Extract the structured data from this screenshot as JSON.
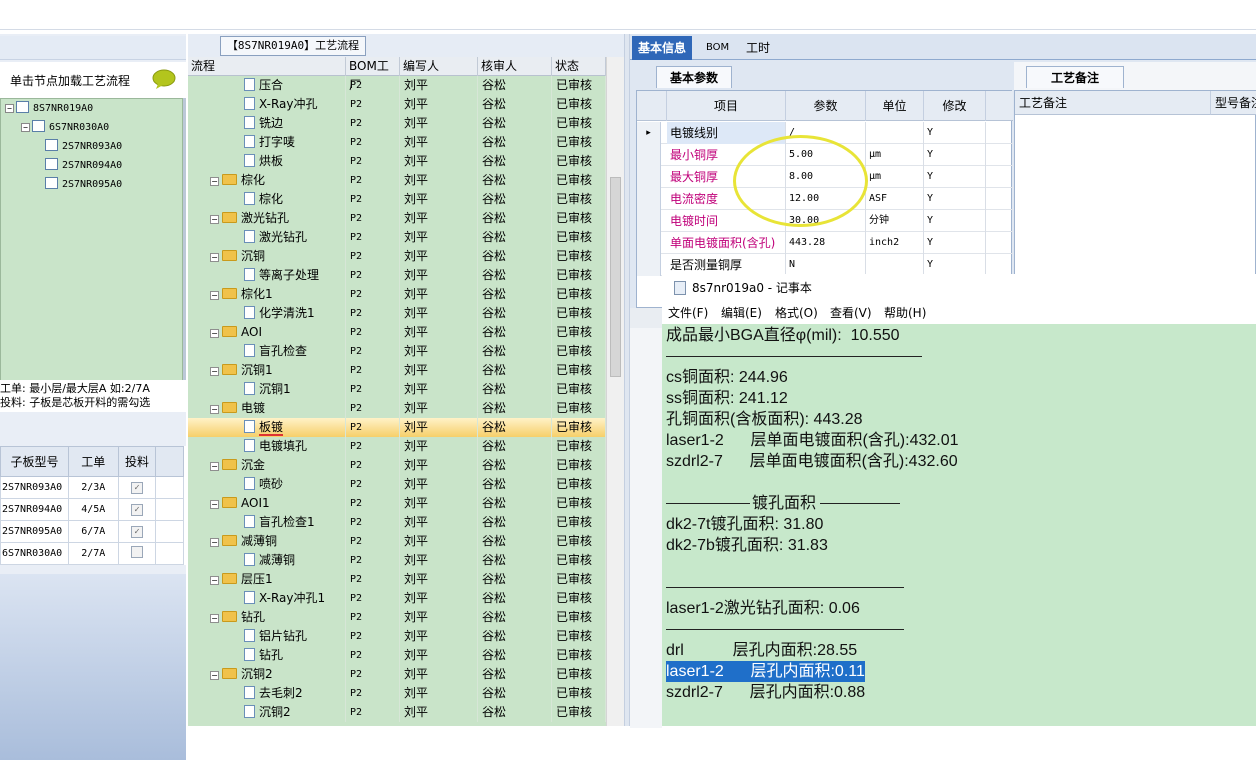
{
  "left": {
    "action_label": "单击节点加载工艺流程",
    "tree": [
      {
        "label": "8S7NR019A0",
        "level": 0
      },
      {
        "label": "6S7NR030A0",
        "level": 1
      },
      {
        "label": "2S7NR093A0",
        "level": 2
      },
      {
        "label": "2S7NR094A0",
        "level": 2
      },
      {
        "label": "2S7NR095A0",
        "level": 2
      }
    ],
    "info_line1": "工单: 最小层/最大层A 如:2/7A",
    "info_line2": "投料: 子板是芯板开料的需勾选",
    "grid_headers": {
      "model": "子板型号",
      "order": "工单",
      "feed": "投料"
    },
    "grid_rows": [
      {
        "model": "2S7NR093A0",
        "order": "2/3A",
        "checked": true
      },
      {
        "model": "2S7NR094A0",
        "order": "4/5A",
        "checked": true
      },
      {
        "model": "2S7NR095A0",
        "order": "6/7A",
        "checked": true
      },
      {
        "model": "6S7NR030A0",
        "order": "2/7A",
        "checked": false
      }
    ]
  },
  "mid": {
    "title": "【8S7NR019A0】工艺流程",
    "headers": {
      "flow": "流程",
      "bom": "BOM工厂",
      "writer": "编写人",
      "reviewer": "核审人",
      "status": "状态"
    },
    "rows": [
      {
        "name": "压合",
        "kind": "doc",
        "bom": "P2",
        "writer": "刘平",
        "reviewer": "谷松",
        "status": "已审核"
      },
      {
        "name": "X-Ray冲孔",
        "kind": "doc",
        "bom": "P2",
        "writer": "刘平",
        "reviewer": "谷松",
        "status": "已审核"
      },
      {
        "name": "铣边",
        "kind": "doc",
        "bom": "P2",
        "writer": "刘平",
        "reviewer": "谷松",
        "status": "已审核"
      },
      {
        "name": "打字唛",
        "kind": "doc",
        "bom": "P2",
        "writer": "刘平",
        "reviewer": "谷松",
        "status": "已审核"
      },
      {
        "name": "烘板",
        "kind": "doc",
        "bom": "P2",
        "writer": "刘平",
        "reviewer": "谷松",
        "status": "已审核"
      },
      {
        "name": "棕化",
        "kind": "folder",
        "bom": "P2",
        "writer": "刘平",
        "reviewer": "谷松",
        "status": "已审核"
      },
      {
        "name": "棕化",
        "kind": "doc",
        "bom": "P2",
        "writer": "刘平",
        "reviewer": "谷松",
        "status": "已审核"
      },
      {
        "name": "激光钻孔",
        "kind": "folder",
        "bom": "P2",
        "writer": "刘平",
        "reviewer": "谷松",
        "status": "已审核"
      },
      {
        "name": "激光钻孔",
        "kind": "doc",
        "bom": "P2",
        "writer": "刘平",
        "reviewer": "谷松",
        "status": "已审核"
      },
      {
        "name": "沉铜",
        "kind": "folder",
        "bom": "P2",
        "writer": "刘平",
        "reviewer": "谷松",
        "status": "已审核"
      },
      {
        "name": "等离子处理",
        "kind": "doc",
        "bom": "P2",
        "writer": "刘平",
        "reviewer": "谷松",
        "status": "已审核"
      },
      {
        "name": "棕化1",
        "kind": "folder",
        "bom": "P2",
        "writer": "刘平",
        "reviewer": "谷松",
        "status": "已审核"
      },
      {
        "name": "化学清洗1",
        "kind": "doc",
        "bom": "P2",
        "writer": "刘平",
        "reviewer": "谷松",
        "status": "已审核"
      },
      {
        "name": "AOI",
        "kind": "folder",
        "bom": "P2",
        "writer": "刘平",
        "reviewer": "谷松",
        "status": "已审核"
      },
      {
        "name": "盲孔检查",
        "kind": "doc",
        "bom": "P2",
        "writer": "刘平",
        "reviewer": "谷松",
        "status": "已审核"
      },
      {
        "name": "沉铜1",
        "kind": "folder",
        "bom": "P2",
        "writer": "刘平",
        "reviewer": "谷松",
        "status": "已审核"
      },
      {
        "name": "沉铜1",
        "kind": "doc",
        "bom": "P2",
        "writer": "刘平",
        "reviewer": "谷松",
        "status": "已审核"
      },
      {
        "name": "电镀",
        "kind": "folder",
        "bom": "P2",
        "writer": "刘平",
        "reviewer": "谷松",
        "status": "已审核"
      },
      {
        "name": "板镀",
        "kind": "doc",
        "bom": "P2",
        "writer": "刘平",
        "reviewer": "谷松",
        "status": "已审核",
        "selected": true
      },
      {
        "name": "电镀填孔",
        "kind": "doc",
        "bom": "P2",
        "writer": "刘平",
        "reviewer": "谷松",
        "status": "已审核"
      },
      {
        "name": "沉金",
        "kind": "folder",
        "bom": "P2",
        "writer": "刘平",
        "reviewer": "谷松",
        "status": "已审核"
      },
      {
        "name": "喷砂",
        "kind": "doc",
        "bom": "P2",
        "writer": "刘平",
        "reviewer": "谷松",
        "status": "已审核"
      },
      {
        "name": "AOI1",
        "kind": "folder",
        "bom": "P2",
        "writer": "刘平",
        "reviewer": "谷松",
        "status": "已审核"
      },
      {
        "name": "盲孔检查1",
        "kind": "doc",
        "bom": "P2",
        "writer": "刘平",
        "reviewer": "谷松",
        "status": "已审核"
      },
      {
        "name": "减薄铜",
        "kind": "folder",
        "bom": "P2",
        "writer": "刘平",
        "reviewer": "谷松",
        "status": "已审核"
      },
      {
        "name": "减薄铜",
        "kind": "doc",
        "bom": "P2",
        "writer": "刘平",
        "reviewer": "谷松",
        "status": "已审核"
      },
      {
        "name": "层压1",
        "kind": "folder",
        "bom": "P2",
        "writer": "刘平",
        "reviewer": "谷松",
        "status": "已审核"
      },
      {
        "name": "X-Ray冲孔1",
        "kind": "doc",
        "bom": "P2",
        "writer": "刘平",
        "reviewer": "谷松",
        "status": "已审核"
      },
      {
        "name": "钻孔",
        "kind": "folder",
        "bom": "P2",
        "writer": "刘平",
        "reviewer": "谷松",
        "status": "已审核"
      },
      {
        "name": "铝片钻孔",
        "kind": "doc",
        "bom": "P2",
        "writer": "刘平",
        "reviewer": "谷松",
        "status": "已审核"
      },
      {
        "name": "钻孔",
        "kind": "doc",
        "bom": "P2",
        "writer": "刘平",
        "reviewer": "谷松",
        "status": "已审核"
      },
      {
        "name": "沉铜2",
        "kind": "folder",
        "bom": "P2",
        "writer": "刘平",
        "reviewer": "谷松",
        "status": "已审核"
      },
      {
        "name": "去毛刺2",
        "kind": "doc",
        "bom": "P2",
        "writer": "刘平",
        "reviewer": "谷松",
        "status": "已审核"
      },
      {
        "name": "沉铜2",
        "kind": "doc",
        "bom": "P2",
        "writer": "刘平",
        "reviewer": "谷松",
        "status": "已审核"
      }
    ]
  },
  "right": {
    "tabs": [
      "基本信息",
      "BOM",
      "工时"
    ],
    "subtab_basic": "基本参数",
    "subtab_note": "工艺备注",
    "param_headers": {
      "item": "项目",
      "param": "参数",
      "unit": "单位",
      "modify": "修改"
    },
    "params": [
      {
        "item": "电镀线别",
        "value": "/",
        "unit": "",
        "modify": "Y",
        "red": false,
        "current": true
      },
      {
        "item": "最小铜厚",
        "value": "5.00",
        "unit": "μm",
        "modify": "Y",
        "red": true
      },
      {
        "item": "最大铜厚",
        "value": "8.00",
        "unit": "μm",
        "modify": "Y",
        "red": true
      },
      {
        "item": "电流密度",
        "value": "12.00",
        "unit": "ASF",
        "modify": "Y",
        "red": true
      },
      {
        "item": "电镀时间",
        "value": "30.00",
        "unit": "分钟",
        "modify": "Y",
        "red": true
      },
      {
        "item": "单面电镀面积(含孔)",
        "value": "443.28",
        "unit": "inch2",
        "modify": "Y",
        "red": true
      },
      {
        "item": "是否测量铜厚",
        "value": "N",
        "unit": "",
        "modify": "Y",
        "red": false
      }
    ],
    "note_headers": {
      "note": "工艺备注",
      "model_note": "型号备注"
    }
  },
  "notepad": {
    "title": "8s7nr019a0 - 记事本",
    "menu": [
      "文件(F)",
      "编辑(E)",
      "格式(O)",
      "查看(V)",
      "帮助(H)"
    ],
    "lines": [
      "成品最小BGA直径φ(mil):  10.550",
      "cs铜面积: 244.96",
      "ss铜面积: 241.12",
      "孔铜面积(含板面积): 443.28",
      "laser1-2      层单面电镀面积(含孔):432.01",
      "szdrl2-7      层单面电镀面积(含孔):432.60",
      "镀孔面积",
      "dk2-7t镀孔面积: 31.80",
      "dk2-7b镀孔面积: 31.83",
      "laser1-2激光钻孔面积: 0.06",
      "drl           层孔内面积:28.55",
      "laser1-2      层孔内面积:0.11",
      "szdrl2-7      层孔内面积:0.88"
    ]
  }
}
